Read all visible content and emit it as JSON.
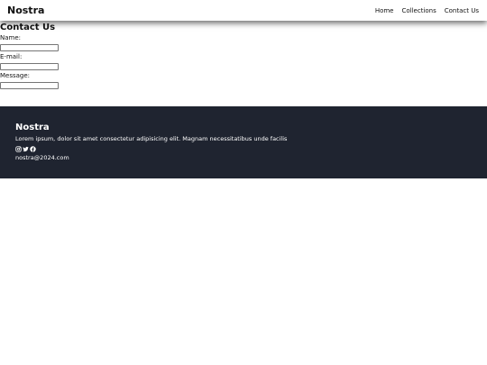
{
  "navbar": {
    "brand": "Nostra",
    "links": [
      {
        "label": "Home"
      },
      {
        "label": "Collections"
      },
      {
        "label": "Contact Us"
      }
    ]
  },
  "contact": {
    "title": "Contact Us",
    "fields": [
      {
        "label": "Name:",
        "value": ""
      },
      {
        "label": "E-mail:",
        "value": ""
      },
      {
        "label": "Message:",
        "value": ""
      }
    ]
  },
  "footer": {
    "brand": "Nostra",
    "description": "Lorem ipsum, dolor sit amet consectetur adipisicing elit. Magnam necessitatibus unde facilis",
    "social_icons": [
      "instagram-icon",
      "twitter-icon",
      "facebook-icon"
    ],
    "email": "nostra@2024.com"
  },
  "colors": {
    "footer_bg": "#1f2430",
    "text_dark": "#111111",
    "text_light": "#ffffff"
  }
}
